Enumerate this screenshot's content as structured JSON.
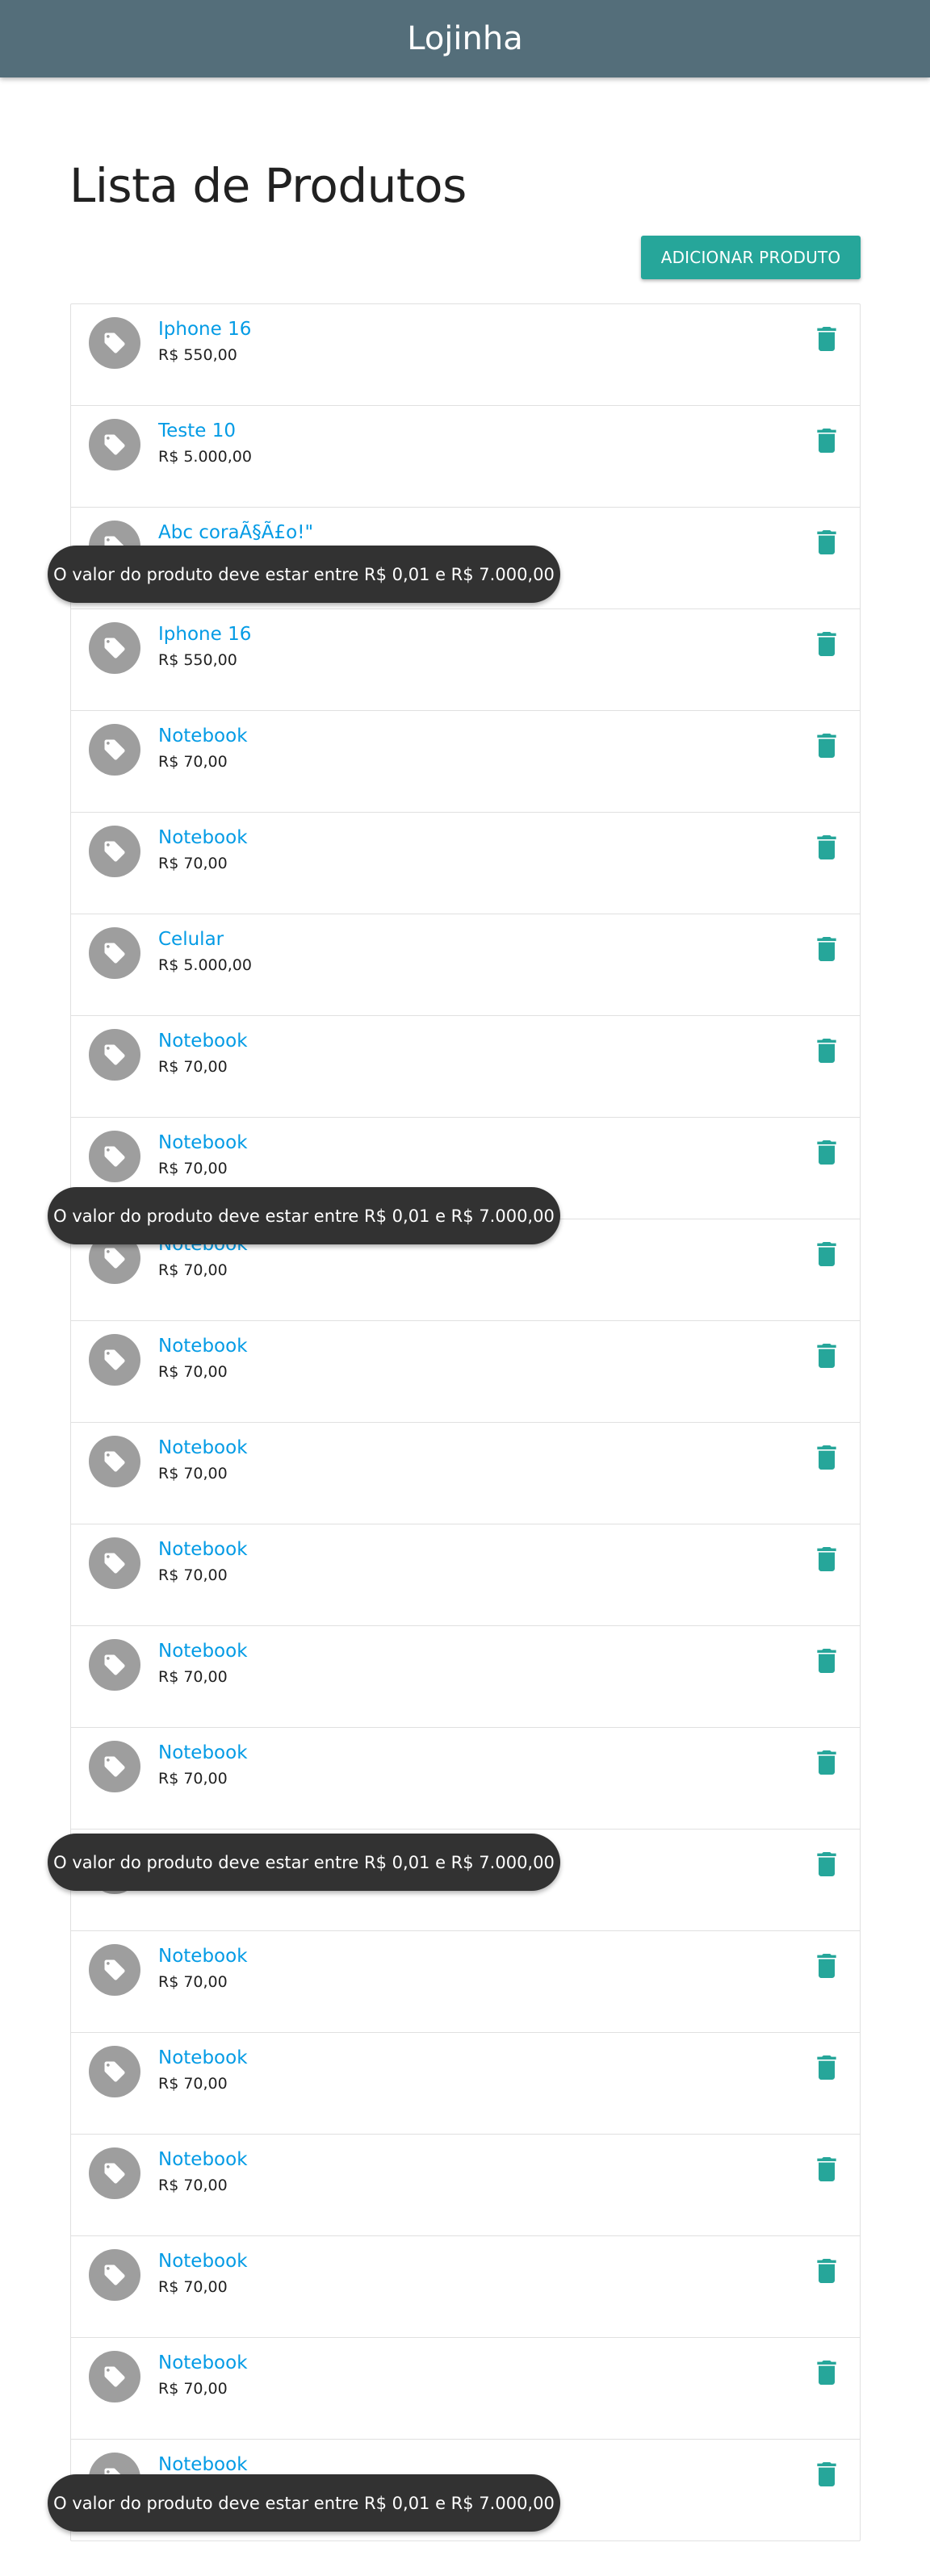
{
  "header": {
    "title": "Lojinha"
  },
  "page": {
    "title": "Lista de Produtos",
    "add_button": "ADICIONAR PRODUTO"
  },
  "colors": {
    "appbar": "#546e7a",
    "accent": "#26a69a",
    "link": "#039be5",
    "toast": "#323232"
  },
  "products": [
    {
      "name": "Iphone 16",
      "price": "R$ 550,00"
    },
    {
      "name": "Teste 10",
      "price": "R$ 5.000,00"
    },
    {
      "name": "Abc coraÃ§Ã£o!\"",
      "price": ""
    },
    {
      "name": "Iphone 16",
      "price": "R$ 550,00"
    },
    {
      "name": "Notebook",
      "price": "R$ 70,00"
    },
    {
      "name": "Notebook",
      "price": "R$ 70,00"
    },
    {
      "name": "Celular",
      "price": "R$ 5.000,00"
    },
    {
      "name": "Notebook",
      "price": "R$ 70,00"
    },
    {
      "name": "Notebook",
      "price": "R$ 70,00"
    },
    {
      "name": "Notebook",
      "price": "R$ 70,00"
    },
    {
      "name": "Notebook",
      "price": "R$ 70,00"
    },
    {
      "name": "Notebook",
      "price": "R$ 70,00"
    },
    {
      "name": "Notebook",
      "price": "R$ 70,00"
    },
    {
      "name": "Notebook",
      "price": "R$ 70,00"
    },
    {
      "name": "Notebook",
      "price": "R$ 70,00"
    },
    {
      "name": "",
      "price": ""
    },
    {
      "name": "Notebook",
      "price": "R$ 70,00"
    },
    {
      "name": "Notebook",
      "price": "R$ 70,00"
    },
    {
      "name": "Notebook",
      "price": "R$ 70,00"
    },
    {
      "name": "Notebook",
      "price": "R$ 70,00"
    },
    {
      "name": "Notebook",
      "price": "R$ 70,00"
    },
    {
      "name": "Notebook",
      "price": ""
    }
  ],
  "toasts": [
    "O valor do produto deve estar entre R$ 0,01 e R$ 7.000,00",
    "O valor do produto deve estar entre R$ 0,01 e R$ 7.000,00",
    "O valor do produto deve estar entre R$ 0,01 e R$ 7.000,00",
    "O valor do produto deve estar entre R$ 0,01 e R$ 7.000,00"
  ]
}
